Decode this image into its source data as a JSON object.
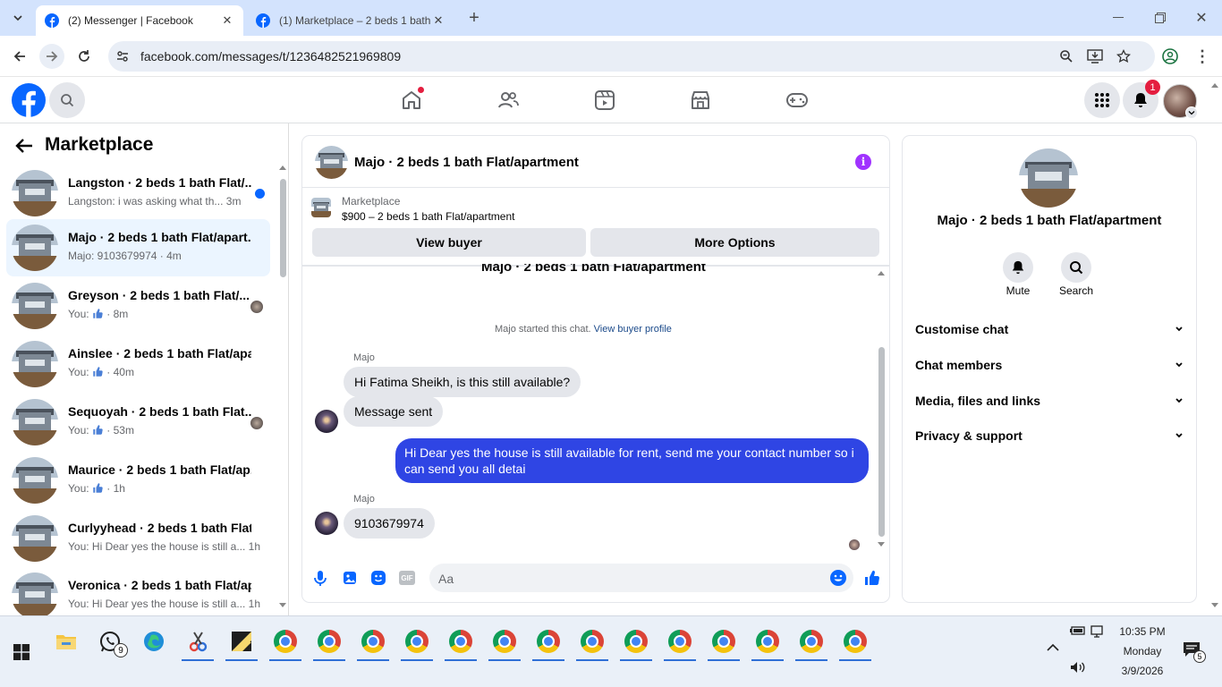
{
  "browser": {
    "tabs": [
      {
        "title": "(2) Messenger | Facebook"
      },
      {
        "title": "(1) Marketplace – 2 beds 1 bath"
      }
    ],
    "url": "facebook.com/messages/t/1236482521969809"
  },
  "header": {
    "notif_count": "1"
  },
  "left": {
    "title": "Marketplace",
    "conversations": [
      {
        "name": "Langston · 2 beds 1 bath Flat/...",
        "preview": "Langston: i was asking what th...",
        "time": "3m"
      },
      {
        "name": "Majo · 2 beds 1 bath Flat/apart...",
        "preview": "Majo: 9103679974 · 4m",
        "time": ""
      },
      {
        "name": "Greyson · 2 beds 1 bath Flat/...",
        "preview": "You:",
        "time": "· 8m"
      },
      {
        "name": "Ainslee · 2 beds 1 bath Flat/apa...",
        "preview": "You:",
        "time": "· 40m"
      },
      {
        "name": "Sequoyah · 2 beds 1 bath Flat...",
        "preview": "You:",
        "time": "· 53m"
      },
      {
        "name": "Maurice · 2 beds 1 bath Flat/ap...",
        "preview": "You:",
        "time": "· 1h"
      },
      {
        "name": "Curlyyhead · 2 beds 1 bath Flat/...",
        "preview": "You: Hi Dear yes the house is still a...",
        "time": "1h"
      },
      {
        "name": "Veronica · 2 beds 1 bath Flat/ap...",
        "preview": "You: Hi Dear yes the house is still a...",
        "time": "1h"
      }
    ]
  },
  "chat": {
    "title": "Majo · 2 beds 1 bath Flat/apartment",
    "listing_source": "Marketplace",
    "listing_price": "$900 – 2 beds 1 bath Flat/apartment",
    "view_buyer": "View buyer",
    "more_options": "More Options",
    "started_text": "Majo started this chat.",
    "view_profile": "View buyer profile",
    "sender1": "Majo",
    "msg1": "Hi Fatima Sheikh, is this still available?",
    "msg2": "Message sent",
    "msg3": "Hi Dear yes the house is still available for rent, send me your contact number so i can send you all detai",
    "sender2": "Majo",
    "msg4": "9103679974",
    "input_placeholder": "Aa"
  },
  "right": {
    "name": "Majo · 2 beds 1 bath Flat/apartment",
    "mute": "Mute",
    "search": "Search",
    "sections": [
      "Customise chat",
      "Chat members",
      "Media, files and links",
      "Privacy & support"
    ]
  },
  "taskbar": {
    "whatsapp_badge": "9",
    "time": "10:35 PM",
    "day": "Monday",
    "date": "3/9/2026",
    "notif_badge": "5"
  }
}
